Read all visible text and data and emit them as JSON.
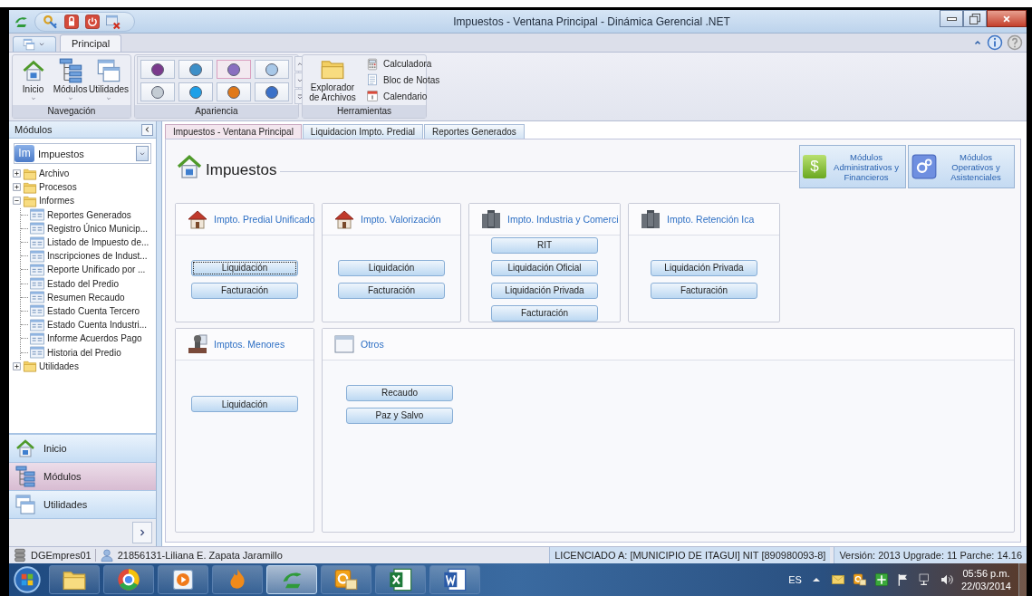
{
  "window": {
    "title": "Impuestos - Ventana Principal - Dinámica Gerencial .NET"
  },
  "ribbon": {
    "tabs": [
      {
        "label": "Principal",
        "selected": true
      }
    ],
    "groups": [
      {
        "kind": "navigation",
        "label": "Navegación",
        "buttons": [
          {
            "label": "Inicio"
          },
          {
            "label": "Módulos"
          },
          {
            "label": "Utilidades"
          }
        ]
      },
      {
        "kind": "gallery",
        "label": "Apariencia",
        "swatches": [
          {
            "color": "#7a3a8c",
            "selected": false
          },
          {
            "color": "#3d8fc8",
            "selected": false
          },
          {
            "color": "#8a6fc0",
            "selected": true
          },
          {
            "color": "#a8c8e8",
            "selected": false
          },
          {
            "color": "#c4ccd4",
            "selected": false
          },
          {
            "color": "#1ea0e8",
            "selected": false
          },
          {
            "color": "#e07818",
            "selected": false
          },
          {
            "color": "#3a70c8",
            "selected": false
          }
        ]
      },
      {
        "kind": "tools",
        "label": "Herramientas",
        "large": {
          "label": "Explorador de Archivos"
        },
        "items": [
          {
            "label": "Calculadora"
          },
          {
            "label": "Bloc de Notas"
          },
          {
            "label": "Calendario"
          }
        ]
      }
    ]
  },
  "sidebar": {
    "title": "Módulos",
    "module_select": {
      "icon_text": "Im",
      "value": "Impuestos"
    },
    "tree": [
      {
        "label": "Archivo",
        "expanded": false
      },
      {
        "label": "Procesos",
        "expanded": false
      },
      {
        "label": "Informes",
        "expanded": true,
        "children": [
          {
            "label": "Reportes Generados"
          },
          {
            "label": "Registro Único Municip..."
          },
          {
            "label": "Listado de Impuesto de..."
          },
          {
            "label": "Inscripciones de Indust..."
          },
          {
            "label": "Reporte Unificado por ..."
          },
          {
            "label": "Estado del Predio"
          },
          {
            "label": "Resumen Recaudo"
          },
          {
            "label": "Estado Cuenta Tercero"
          },
          {
            "label": "Estado Cuenta Industri..."
          },
          {
            "label": "Informe Acuerdos Pago"
          },
          {
            "label": "Historia del Predio"
          }
        ]
      },
      {
        "label": "Utilidades",
        "expanded": false
      }
    ],
    "nav": [
      {
        "label": "Inicio",
        "selected": false
      },
      {
        "label": "Módulos",
        "selected": true
      },
      {
        "label": "Utilidades",
        "selected": false
      }
    ]
  },
  "content": {
    "tabs": [
      {
        "label": "Impuestos - Ventana Principal",
        "selected": true
      },
      {
        "label": "Liquidacion Impto. Predial",
        "selected": false
      },
      {
        "label": "Reportes Generados",
        "selected": false
      }
    ],
    "title": "Impuestos",
    "module_buttons": [
      {
        "label": "Módulos Administrativos y Financieros",
        "icon_text": "$"
      },
      {
        "label": "Módulos Operativos y Asistenciales"
      }
    ],
    "card_rows": [
      [
        {
          "title": "Impto. Predial Unificado",
          "buttons": [
            {
              "label": "Liquidación",
              "focused": true
            },
            {
              "label": "Facturación",
              "focused": false
            }
          ]
        },
        {
          "title": "Impto. Valorización",
          "buttons": [
            {
              "label": "Liquidación",
              "focused": false
            },
            {
              "label": "Facturación",
              "focused": false
            }
          ]
        },
        {
          "title": "Impto. Industria y Comerci",
          "buttons": [
            {
              "label": "RIT",
              "focused": false
            },
            {
              "label": "Liquidación Oficial",
              "focused": false
            },
            {
              "label": "Liquidación Privada",
              "focused": false
            },
            {
              "label": "Facturación",
              "focused": false
            }
          ]
        },
        {
          "title": "Impto. Retención Ica",
          "buttons": [
            {
              "label": "Liquidación Privada",
              "focused": false
            },
            {
              "label": "Facturación",
              "focused": false
            }
          ]
        }
      ],
      [
        {
          "title": "Imptos. Menores",
          "buttons": [
            {
              "label": "Liquidación",
              "focused": false
            }
          ]
        },
        {
          "title": "Otros",
          "buttons": [
            {
              "label": "Recaudo",
              "focused": false
            },
            {
              "label": "Paz y Salvo",
              "focused": false
            }
          ]
        }
      ]
    ]
  },
  "status_bar": {
    "database": "DGEmpres01",
    "user": "21856131-Liliana E. Zapata Jaramillo",
    "license": "LICENCIADO A: [MUNICIPIO DE ITAGUI] NIT [890980093-8]",
    "version": "Versión: 2013 Upgrade: 11 Parche: 14.16"
  },
  "taskbar": {
    "apps": [
      {
        "active": false
      },
      {
        "active": false
      },
      {
        "active": false
      },
      {
        "active": false
      },
      {
        "active": true
      },
      {
        "active": false
      },
      {
        "active": false
      },
      {
        "active": false
      }
    ],
    "tray": {
      "language": "ES",
      "time": "05:56 p.m.",
      "date": "22/03/2014"
    }
  }
}
